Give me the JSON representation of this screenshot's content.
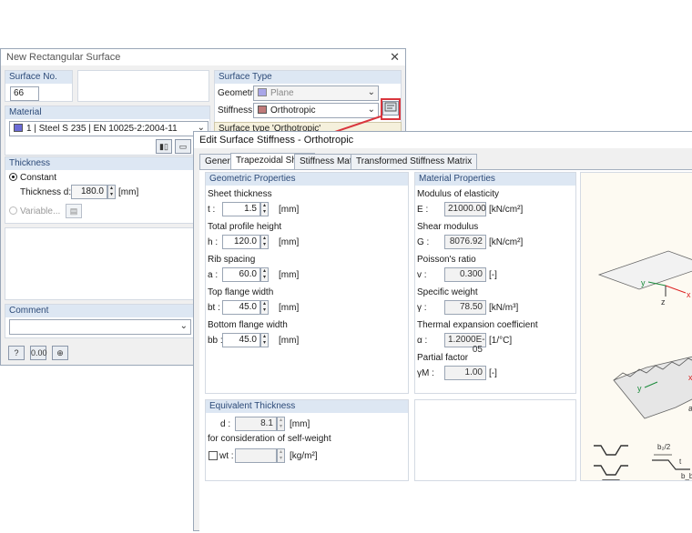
{
  "rect_dialog": {
    "title": "New Rectangular Surface",
    "surface_no_label": "Surface No.",
    "surface_no_value": "66",
    "surface_type_label": "Surface Type",
    "geometry_label": "Geometry:",
    "geometry_value": "Plane",
    "stiffness_label": "Stiffness:",
    "stiffness_value": "Orthotropic",
    "surface_type_note": "Surface type 'Orthotropic'",
    "material_label": "Material",
    "material_value": "1 | Steel S 235 | EN 10025-2:2004-11",
    "thickness_label": "Thickness",
    "constant_label": "Constant",
    "thickness_d_label": "Thickness d:",
    "thickness_d_value": "180.0",
    "thickness_unit": "[mm]",
    "variable_label": "Variable...",
    "comment_label": "Comment",
    "colors": {
      "geometry_swatch": "#a9a6e8",
      "stiffness_swatch": "#c07a7a",
      "material_swatch": "#6b6bd6"
    }
  },
  "stiff_dialog": {
    "title": "Edit Surface Stiffness - Orthotropic",
    "tabs": [
      "General",
      "Trapezoidal Sheet",
      "Stiffness Matrix",
      "Transformed Stiffness Matrix"
    ],
    "geometric_header": "Geometric Properties",
    "geo": [
      {
        "label": "Sheet thickness",
        "sym": "t :",
        "value": "1.5",
        "unit": "[mm]"
      },
      {
        "label": "Total profile height",
        "sym": "h :",
        "value": "120.0",
        "unit": "[mm]"
      },
      {
        "label": "Rib spacing",
        "sym": "a :",
        "value": "60.0",
        "unit": "[mm]"
      },
      {
        "label": "Top flange width",
        "sym": "bt :",
        "value": "45.0",
        "unit": "[mm]"
      },
      {
        "label": "Bottom flange width",
        "sym": "bb :",
        "value": "45.0",
        "unit": "[mm]"
      }
    ],
    "material_header": "Material Properties",
    "mat": [
      {
        "label": "Modulus of elasticity",
        "sym": "E :",
        "value": "21000.00",
        "unit": "[kN/cm²]"
      },
      {
        "label": "Shear modulus",
        "sym": "G :",
        "value": "8076.92",
        "unit": "[kN/cm²]"
      },
      {
        "label": "Poisson's ratio",
        "sym": "v :",
        "value": "0.300",
        "unit": "[-]"
      },
      {
        "label": "Specific weight",
        "sym": "γ :",
        "value": "78.50",
        "unit": "[kN/m³]"
      },
      {
        "label": "Thermal expansion coefficient",
        "sym": "α :",
        "value": "1.2000E-05",
        "unit": "[1/°C]"
      },
      {
        "label": "Partial factor",
        "sym": "γM :",
        "value": "1.00",
        "unit": "[-]"
      }
    ],
    "equiv_header": "Equivalent Thickness",
    "equiv_d_sym": "d :",
    "equiv_d_value": "8.1",
    "equiv_d_unit": "[mm]",
    "self_weight_label": "for consideration of self-weight",
    "wt_label": "wt :",
    "wt_unit": "[kg/m²]",
    "fig_labels": {
      "b2": "b₂/2",
      "t": "t",
      "bb": "b_b",
      "x": "x",
      "y": "y",
      "z": "z",
      "a": "a"
    }
  }
}
